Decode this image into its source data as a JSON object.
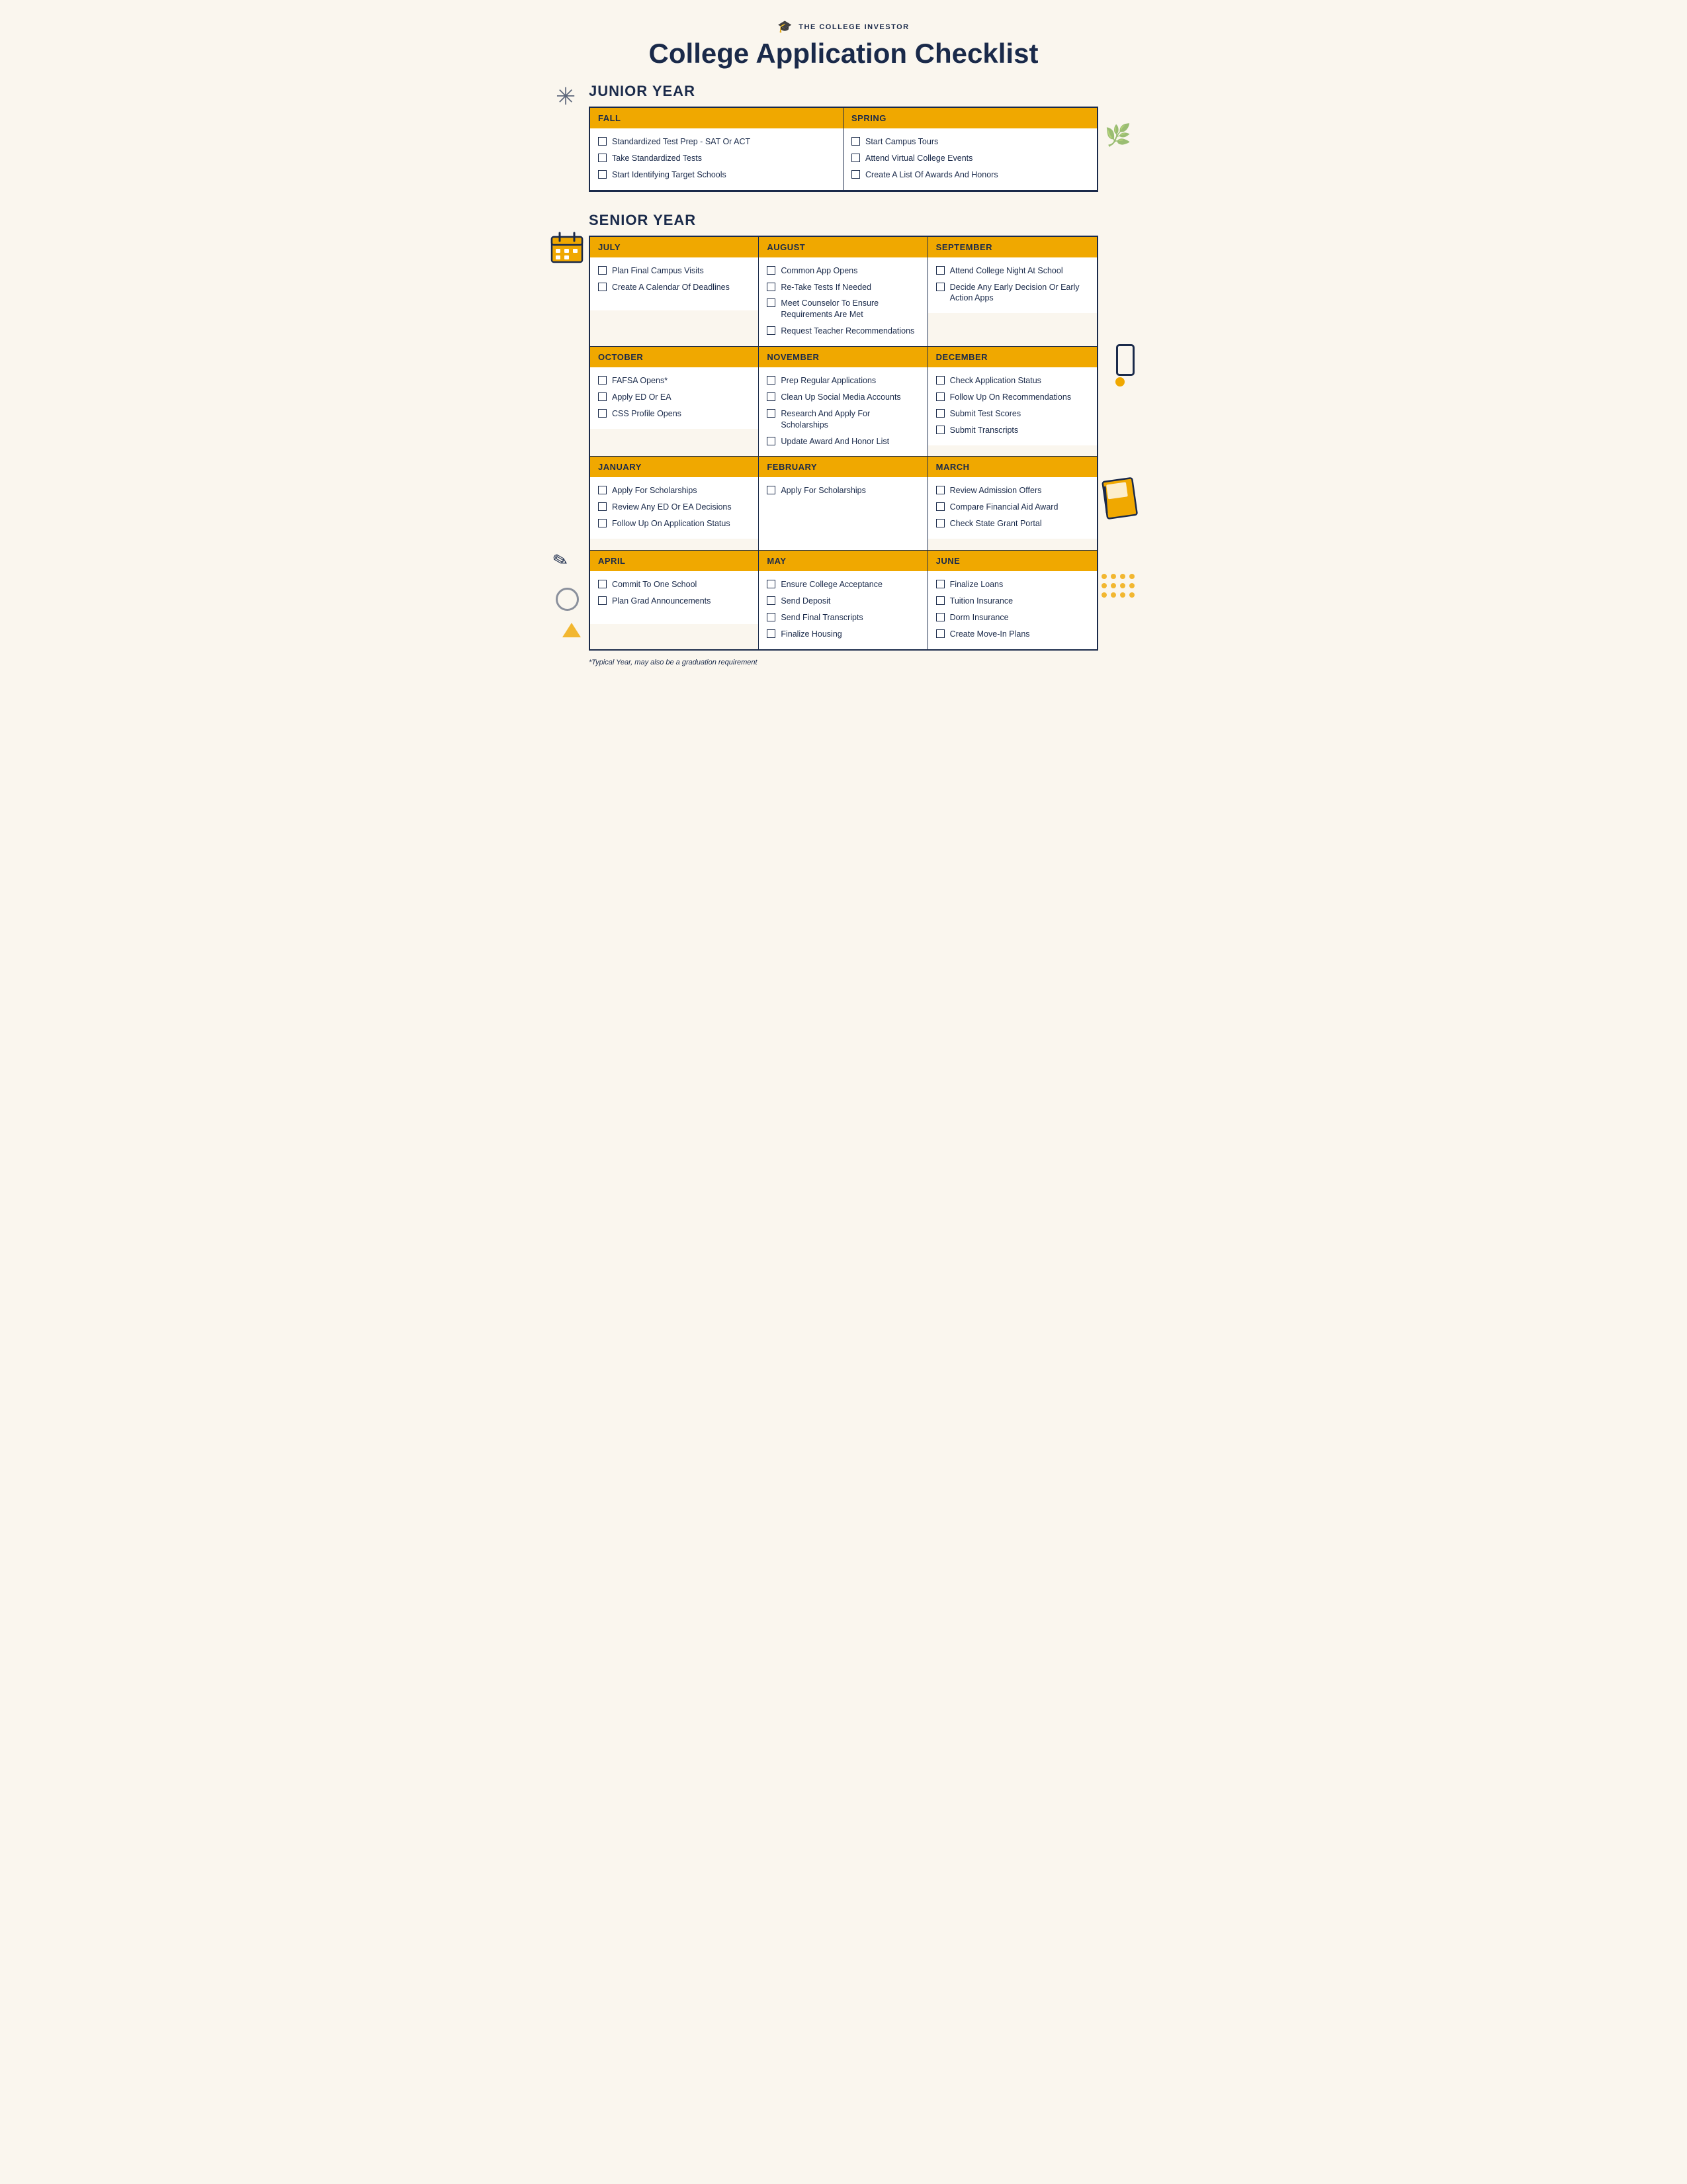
{
  "brand": {
    "icon": "🎓",
    "name": "THE COLLEGE INVESTOR"
  },
  "title": "College Application Checklist",
  "sections": {
    "junior": {
      "label": "JUNIOR YEAR",
      "months": [
        {
          "id": "fall",
          "name": "FALL",
          "items": [
            "Standardized Test Prep - SAT Or ACT",
            "Take Standardized Tests",
            "Start Identifying Target Schools"
          ]
        },
        {
          "id": "spring",
          "name": "SPRING",
          "items": [
            "Start Campus Tours",
            "Attend Virtual College Events",
            "Create A List Of Awards And Honors"
          ]
        }
      ]
    },
    "senior": {
      "label": "SENIOR YEAR",
      "rows": [
        [
          {
            "id": "july",
            "name": "JULY",
            "items": [
              "Plan Final Campus Visits",
              "Create A Calendar Of Deadlines"
            ]
          },
          {
            "id": "august",
            "name": "AUGUST",
            "items": [
              "Common App Opens",
              "Re-Take Tests If Needed",
              "Meet Counselor To Ensure Requirements Are Met",
              "Request Teacher Recommendations"
            ]
          },
          {
            "id": "september",
            "name": "SEPTEMBER",
            "items": [
              "Attend College Night At School",
              "Decide Any Early Decision Or Early Action Apps"
            ]
          }
        ],
        [
          {
            "id": "october",
            "name": "OCTOBER",
            "items": [
              "FAFSA Opens*",
              "Apply ED Or EA",
              "CSS Profile Opens"
            ]
          },
          {
            "id": "november",
            "name": "NOVEMBER",
            "items": [
              "Prep Regular Applications",
              "Clean Up Social Media Accounts",
              "Research And Apply For Scholarships",
              "Update Award And Honor List"
            ]
          },
          {
            "id": "december",
            "name": "DECEMBER",
            "items": [
              "Check Application Status",
              "Follow Up On Recommendations",
              "Submit Test Scores",
              "Submit Transcripts"
            ]
          }
        ],
        [
          {
            "id": "january",
            "name": "JANUARY",
            "items": [
              "Apply For Scholarships",
              "Review Any ED Or EA Decisions",
              "Follow Up On Application Status"
            ]
          },
          {
            "id": "february",
            "name": "FEBRUARY",
            "items": [
              "Apply For Scholarships"
            ]
          },
          {
            "id": "march",
            "name": "MARCH",
            "items": [
              "Review Admission Offers",
              "Compare Financial Aid Award",
              "Check State Grant Portal"
            ]
          }
        ],
        [
          {
            "id": "april",
            "name": "APRIL",
            "items": [
              "Commit To One School",
              "Plan Grad Announcements"
            ]
          },
          {
            "id": "may",
            "name": "MAY",
            "items": [
              "Ensure College Acceptance",
              "Send Deposit",
              "Send Final Transcripts",
              "Finalize Housing"
            ]
          },
          {
            "id": "june",
            "name": "JUNE",
            "items": [
              "Finalize Loans",
              "Tuition Insurance",
              "Dorm Insurance",
              "Create Move-In Plans"
            ]
          }
        ]
      ]
    }
  },
  "footnote": "*Typical Year, may also be a graduation requirement"
}
